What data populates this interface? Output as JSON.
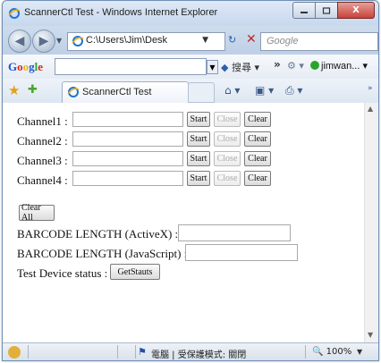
{
  "window": {
    "title": "ScannerCtl Test - Windows Internet Explorer",
    "minimize_icon": "minimize-icon",
    "maximize_icon": "maximize-icon",
    "close_icon": "close-icon",
    "close_glyph": "X"
  },
  "navbar": {
    "address": "C:\\Users\\Jim\\Desk",
    "search_placeholder": "Google",
    "refresh_glyph": "↻",
    "stop_glyph": "✕"
  },
  "google_bar": {
    "logo": "Google",
    "search_label": "搜尋",
    "more_glyph": "»",
    "user": "jimwan..."
  },
  "tabs": [
    {
      "label": "ScannerCtl Test"
    }
  ],
  "page": {
    "channels": [
      {
        "label": "Channel1 :",
        "value": "",
        "start": "Start",
        "close": "Close",
        "clear": "Clear"
      },
      {
        "label": "Channel2 :",
        "value": "",
        "start": "Start",
        "close": "Close",
        "clear": "Clear"
      },
      {
        "label": "Channel3 :",
        "value": "",
        "start": "Start",
        "close": "Close",
        "clear": "Clear"
      },
      {
        "label": "Channel4 :",
        "value": "",
        "start": "Start",
        "close": "Close",
        "clear": "Clear"
      }
    ],
    "clear_all": "Clear All",
    "barcode_activex_label": "BARCODE LENGTH (ActiveX) :",
    "barcode_activex_value": "",
    "barcode_js_label": "BARCODE LENGTH (JavaScript) :",
    "barcode_js_value": "",
    "device_status_label": "Test Device status :",
    "get_status": "GetStauts"
  },
  "statusbar": {
    "zone": "電腦 | 受保護模式: 關閉",
    "zoom": "100%"
  },
  "colors": {
    "titlebar": "#c7d8ee",
    "close_button": "#c9423a",
    "accent": "#2a60b0"
  }
}
